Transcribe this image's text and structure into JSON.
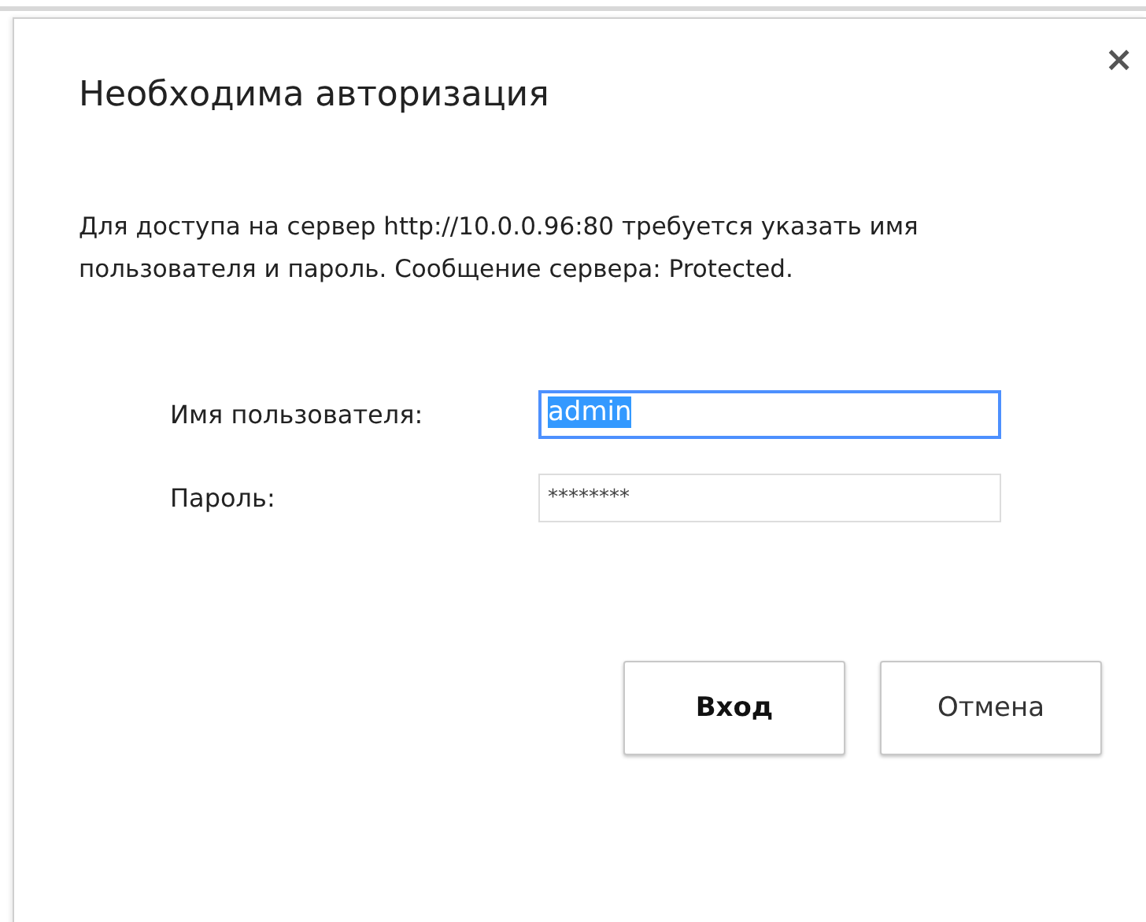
{
  "dialog": {
    "title": "Необходима авторизация",
    "close": "×",
    "message": "Для доступа на сервер http://10.0.0.96:80 требуется указать имя пользователя и пароль. Сообщение сервера: Protected.",
    "fields": [
      {
        "label": "Имя пользователя:",
        "value": "admin",
        "focused": true,
        "text_selected": true
      },
      {
        "label": "Пароль:",
        "value": "********",
        "focused": false,
        "text_selected": false
      }
    ],
    "buttons": [
      {
        "label": "Вход",
        "kind": "primary"
      },
      {
        "label": "Отмена",
        "kind": "secondary"
      }
    ]
  }
}
